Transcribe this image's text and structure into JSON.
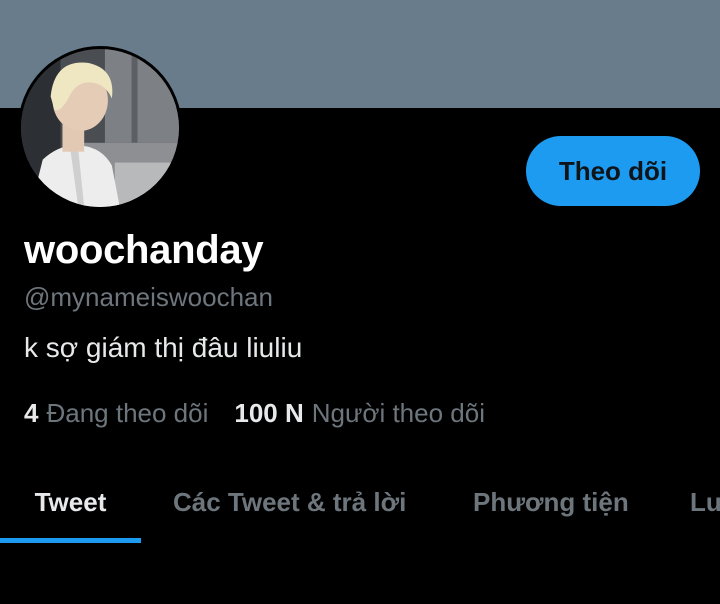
{
  "profile": {
    "display_name": "woochanday",
    "handle": "@mynameiswoochan",
    "bio": "k sợ giám thị đâu liuliu",
    "follow_button": "Theo dõi"
  },
  "stats": {
    "following": {
      "count": "4",
      "label": "Đang theo dõi"
    },
    "followers": {
      "count": "100 N",
      "label": "Người theo dõi"
    }
  },
  "tabs": [
    {
      "label": "Tweet",
      "active": true
    },
    {
      "label": "Các Tweet & trả lời",
      "active": false
    },
    {
      "label": "Phương tiện",
      "active": false
    },
    {
      "label": "Lư",
      "active": false
    }
  ],
  "colors": {
    "banner": "#687c8c",
    "accent": "#1d9bf0",
    "background": "#000000",
    "primary_text": "#e7e9ea",
    "secondary_text": "#6e767d"
  }
}
